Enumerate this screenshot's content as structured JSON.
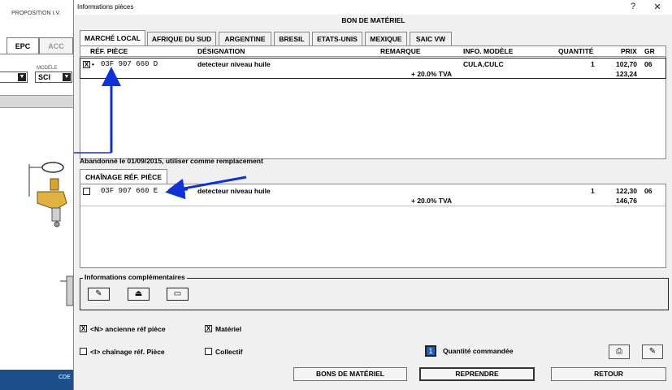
{
  "background_app": {
    "title": "PROPOSITION I.V.",
    "tabs": [
      "EPC",
      "ACC"
    ],
    "modele_label": "MODÈLE",
    "modele_value": "SCI",
    "footer": "CDE"
  },
  "dialog": {
    "title": "Informations pièces",
    "help_label": "?",
    "close_label": "✕",
    "header": "BON DE MATÉRIEL",
    "tabs": [
      "MARCHÉ LOCAL",
      "AFRIQUE DU SUD",
      "ARGENTINE",
      "BRESIL",
      "ETATS-UNIS",
      "MEXIQUE",
      "SAIC VW"
    ],
    "columns": {
      "ref": "RÉF. PIÈCE",
      "designation": "DÉSIGNATION",
      "remarque": "REMARQUE",
      "info": "INFO. MODÈLE",
      "quantite": "QUANTITÉ",
      "prix": "PRIX",
      "gr": "GR"
    },
    "row1": {
      "checked": "X",
      "marker": "•",
      "ref": "03F 907 660 D",
      "designation": "detecteur niveau huile",
      "info": "CULA,CULC",
      "quantite": "1",
      "prix": "102,70",
      "gr": "06",
      "tva_label": "+ 20.0% TVA",
      "prix_ttc": "123,24"
    },
    "abandon_text": "Abandonné le 01/09/2015, utiliser comme remplacement",
    "chain_tab": "CHAÎNAGE RÉF. PIÈCE",
    "row2": {
      "ref": "03F 907 660 E",
      "designation": "detecteur niveau huile",
      "quantite": "1",
      "prix": "122,30",
      "gr": "06",
      "tva_label": "+ 20.0% TVA",
      "prix_ttc": "146,76"
    },
    "info_comp_label": "Informations complémentaires",
    "info_buttons": [
      "pencil-icon",
      "tray-icon",
      "screen-icon"
    ],
    "options": {
      "ancienne": "<N> ancienne réf pièce",
      "materiel": "Matériel",
      "chainage": "<I> chaînage réf. Pièce",
      "collectif": "Collectif",
      "ancienne_checked": "X",
      "materiel_checked": "X"
    },
    "quantity_label": "Quantité commandée",
    "quantity_value": "1",
    "buttons": {
      "bons": "BONS DE MATÉRIEL",
      "reprendre": "REPRENDRE",
      "retour": "RETOUR"
    },
    "arrow_color": "#1030d8"
  }
}
